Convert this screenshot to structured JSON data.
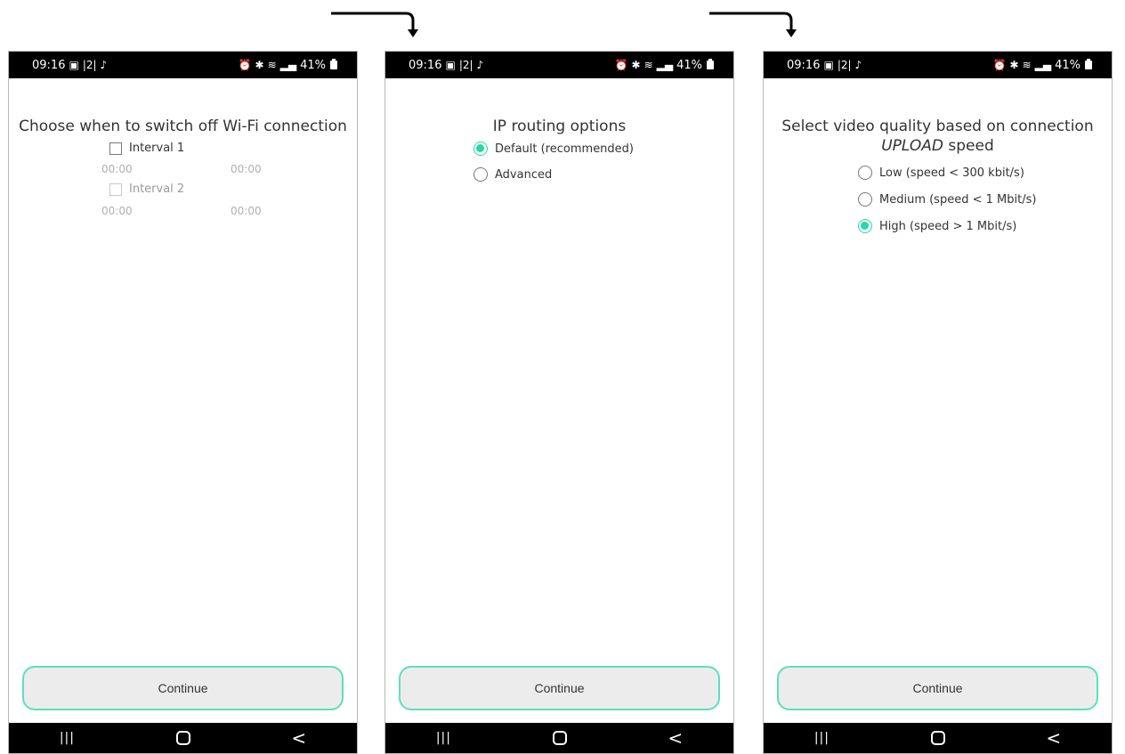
{
  "status_bar": {
    "time": "09:16",
    "gallery_icon": "image-icon",
    "sim_label": "|2|",
    "app_icon": "tiktok-icon",
    "alarm_icon": "alarm-icon",
    "bluetooth_icon": "bluetooth-icon",
    "wifi_icon": "wifi-icon",
    "signal_icon": "signal-icon",
    "battery": "41%"
  },
  "screens": [
    {
      "title": "Choose when to switch off Wi-Fi connection",
      "intervals": [
        {
          "label": "Interval 1",
          "checked": false,
          "enabled": true,
          "start": "00:00",
          "end": "00:00"
        },
        {
          "label": "Interval 2",
          "checked": false,
          "enabled": false,
          "start": "00:00",
          "end": "00:00"
        }
      ],
      "continue_label": "Continue"
    },
    {
      "title": "IP routing options",
      "options": [
        {
          "label": "Default (recommended)",
          "selected": true
        },
        {
          "label": "Advanced",
          "selected": false
        }
      ],
      "continue_label": "Continue"
    },
    {
      "title_line1": "Select video quality based on connection",
      "title_emphasis": "UPLOAD",
      "title_line2_rest": "speed",
      "options": [
        {
          "label": "Low (speed < 300 kbit/s)",
          "selected": false
        },
        {
          "label": "Medium (speed < 1 Mbit/s)",
          "selected": false
        },
        {
          "label": "High (speed > 1 Mbit/s)",
          "selected": true
        }
      ],
      "continue_label": "Continue"
    }
  ],
  "nav_bar": {
    "recent_icon": "recent-apps-icon",
    "recent_glyph": "|||",
    "home_icon": "home-icon",
    "back_icon": "back-icon",
    "back_glyph": "<"
  },
  "colors": {
    "accent": "#26d9a6",
    "button_border": "#5de0bb",
    "button_bg": "#ececec"
  }
}
